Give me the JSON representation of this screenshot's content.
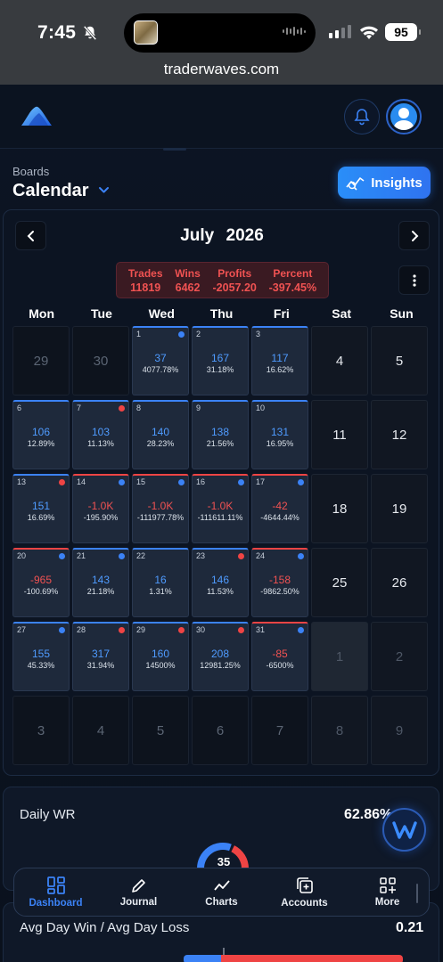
{
  "status_bar": {
    "time": "7:45",
    "battery": "95"
  },
  "browser": {
    "url": "traderwaves.com"
  },
  "header": {
    "logo_icon": "mountain-logo-icon",
    "notification_icon": "bell-icon",
    "avatar_icon": "user-avatar-icon"
  },
  "boards": {
    "label": "Boards",
    "title": "Calendar",
    "insights_label": "Insights"
  },
  "calendar": {
    "month": "July",
    "year": "2026",
    "stats": [
      {
        "label": "Trades",
        "value": "11819"
      },
      {
        "label": "Wins",
        "value": "6462"
      },
      {
        "label": "Profits",
        "value": "-2057.20"
      },
      {
        "label": "Percent",
        "value": "-397.45%"
      }
    ],
    "weekdays": [
      "Mon",
      "Tue",
      "Wed",
      "Thu",
      "Fri",
      "Sat",
      "Sun"
    ],
    "cells": [
      {
        "day": "29",
        "kind": "outside"
      },
      {
        "day": "30",
        "kind": "outside"
      },
      {
        "day": "1",
        "kind": "trade",
        "result": "win",
        "dot": "blue",
        "pnl": "37",
        "pct": "4077.78%"
      },
      {
        "day": "2",
        "kind": "trade",
        "result": "win",
        "dot": "",
        "pnl": "167",
        "pct": "31.18%"
      },
      {
        "day": "3",
        "kind": "trade",
        "result": "win",
        "dot": "",
        "pnl": "117",
        "pct": "16.62%"
      },
      {
        "day": "4",
        "kind": "weekend"
      },
      {
        "day": "5",
        "kind": "weekend"
      },
      {
        "day": "6",
        "kind": "trade",
        "result": "win",
        "dot": "",
        "pnl": "106",
        "pct": "12.89%"
      },
      {
        "day": "7",
        "kind": "trade",
        "result": "win",
        "dot": "red",
        "pnl": "103",
        "pct": "11.13%"
      },
      {
        "day": "8",
        "kind": "trade",
        "result": "win",
        "dot": "",
        "pnl": "140",
        "pct": "28.23%"
      },
      {
        "day": "9",
        "kind": "trade",
        "result": "win",
        "dot": "",
        "pnl": "138",
        "pct": "21.56%"
      },
      {
        "day": "10",
        "kind": "trade",
        "result": "win",
        "dot": "",
        "pnl": "131",
        "pct": "16.95%"
      },
      {
        "day": "11",
        "kind": "weekend"
      },
      {
        "day": "12",
        "kind": "weekend"
      },
      {
        "day": "13",
        "kind": "trade",
        "result": "win",
        "dot": "red",
        "pnl": "151",
        "pct": "16.69%"
      },
      {
        "day": "14",
        "kind": "trade",
        "result": "loss",
        "dot": "blue",
        "pnl": "-1.0K",
        "pct": "-195.90%"
      },
      {
        "day": "15",
        "kind": "trade",
        "result": "loss",
        "dot": "blue",
        "pnl": "-1.0K",
        "pct": "-111977.78%"
      },
      {
        "day": "16",
        "kind": "trade",
        "result": "loss",
        "dot": "blue",
        "pnl": "-1.0K",
        "pct": "-111611.11%"
      },
      {
        "day": "17",
        "kind": "trade",
        "result": "loss",
        "dot": "blue",
        "pnl": "-42",
        "pct": "-4644.44%"
      },
      {
        "day": "18",
        "kind": "weekend"
      },
      {
        "day": "19",
        "kind": "weekend"
      },
      {
        "day": "20",
        "kind": "trade",
        "result": "loss",
        "dot": "blue",
        "pnl": "-965",
        "pct": "-100.69%"
      },
      {
        "day": "21",
        "kind": "trade",
        "result": "win",
        "dot": "blue",
        "pnl": "143",
        "pct": "21.18%"
      },
      {
        "day": "22",
        "kind": "trade",
        "result": "win",
        "dot": "",
        "pnl": "16",
        "pct": "1.31%"
      },
      {
        "day": "23",
        "kind": "trade",
        "result": "win",
        "dot": "red",
        "pnl": "146",
        "pct": "11.53%"
      },
      {
        "day": "24",
        "kind": "trade",
        "result": "loss",
        "dot": "blue",
        "pnl": "-158",
        "pct": "-9862.50%"
      },
      {
        "day": "25",
        "kind": "weekend"
      },
      {
        "day": "26",
        "kind": "weekend"
      },
      {
        "day": "27",
        "kind": "trade",
        "result": "win",
        "dot": "blue",
        "pnl": "155",
        "pct": "45.33%"
      },
      {
        "day": "28",
        "kind": "trade",
        "result": "win",
        "dot": "red",
        "pnl": "317",
        "pct": "31.94%"
      },
      {
        "day": "29",
        "kind": "trade",
        "result": "win",
        "dot": "red",
        "pnl": "160",
        "pct": "14500%"
      },
      {
        "day": "30",
        "kind": "trade",
        "result": "win",
        "dot": "red",
        "pnl": "208",
        "pct": "12981.25%"
      },
      {
        "day": "31",
        "kind": "trade",
        "result": "loss",
        "dot": "blue",
        "pnl": "-85",
        "pct": "-6500%"
      },
      {
        "day": "1",
        "kind": "outside-weekend",
        "shaded": true
      },
      {
        "day": "2",
        "kind": "outside-weekend"
      },
      {
        "day": "3",
        "kind": "outside"
      },
      {
        "day": "4",
        "kind": "outside"
      },
      {
        "day": "5",
        "kind": "outside"
      },
      {
        "day": "6",
        "kind": "outside"
      },
      {
        "day": "7",
        "kind": "outside"
      },
      {
        "day": "8",
        "kind": "outside-weekend"
      },
      {
        "day": "9",
        "kind": "outside-weekend"
      }
    ]
  },
  "daily_wr": {
    "label": "Daily WR",
    "value": "62.86%",
    "gauge_value": "35",
    "gauge_fraction": 0.6286
  },
  "fab": {
    "icon": "w-logo-icon"
  },
  "bottom_nav": [
    {
      "label": "Dashboard",
      "icon": "dashboard-grid-icon",
      "active": true
    },
    {
      "label": "Journal",
      "icon": "pencil-icon",
      "active": false
    },
    {
      "label": "Charts",
      "icon": "line-chart-icon",
      "active": false
    },
    {
      "label": "Accounts",
      "icon": "accounts-plus-icon",
      "active": false
    },
    {
      "label": "More",
      "icon": "more-grid-icon",
      "active": false
    }
  ],
  "avg_day": {
    "label": "Avg Day Win / Avg Day Loss",
    "value": "0.21",
    "win_fraction": 0.17
  },
  "colors": {
    "accent": "#3b82f6",
    "loss": "#ef4444",
    "background": "#0a111d"
  }
}
